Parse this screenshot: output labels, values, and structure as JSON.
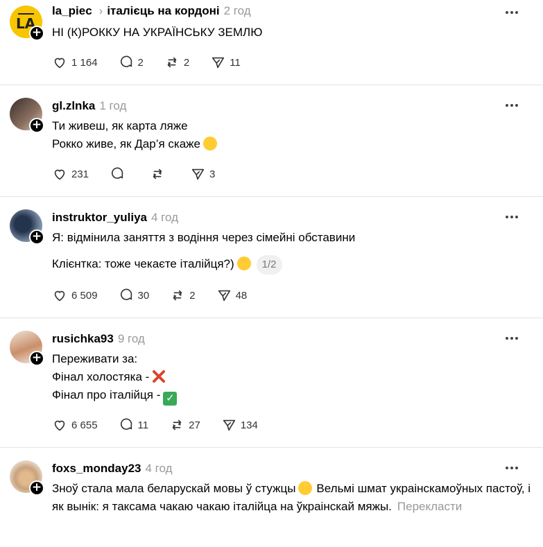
{
  "posts": [
    {
      "username": "la_piec",
      "thread": "італієць на кордоні",
      "time": "2 год",
      "lines": [
        "НІ (К)РОККУ НА УКРАЇНСЬКУ ЗЕМЛЮ"
      ],
      "likes": "1 164",
      "comments": "2",
      "reposts": "2",
      "shares": "11"
    },
    {
      "username": "gl.zlnka",
      "time": "1 год",
      "lines": [
        "Ти живеш, як карта ляже",
        "Рокко живе, як Дар’я скаже"
      ],
      "likes": "231",
      "comments": "",
      "reposts": "",
      "shares": "3"
    },
    {
      "username": "instruktor_yuliya",
      "time": "4 год",
      "lines": [
        "Я: відмінила заняття з водіння через сімейні обставини",
        "Клієнтка: тоже чекаєте італійця?)"
      ],
      "pager": "1/2",
      "likes": "6 509",
      "comments": "30",
      "reposts": "2",
      "shares": "48"
    },
    {
      "username": "rusichka93",
      "time": "9 год",
      "lines": [
        "Переживати за:",
        "Фінал холостяка -",
        "Фінал про італійця -"
      ],
      "likes": "6 655",
      "comments": "11",
      "reposts": "27",
      "shares": "134"
    },
    {
      "username": "foxs_monday23",
      "time": "4 год",
      "lines": [
        "Зноў стала мала беларускай мовы ў стужцы",
        "Вельмі шмат украінскамоўных пастоў, і як вынік: я таксама чакаю чакаю італійца на ўкраінскай мяжы."
      ],
      "translate": "Перекласти"
    }
  ]
}
